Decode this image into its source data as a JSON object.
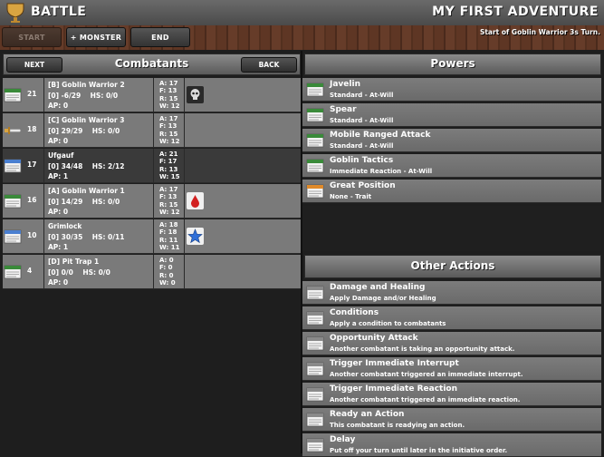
{
  "header": {
    "title": "BATTLE",
    "adventure": "MY FIRST ADVENTURE"
  },
  "toolbar": {
    "start_label": "START",
    "monster_label": "+ MONSTER",
    "end_label": "END",
    "turn_status": "Start of Goblin Warrior 3s Turn."
  },
  "combatants_panel": {
    "title": "Combatants",
    "next_label": "NEXT",
    "back_label": "BACK"
  },
  "combatants": [
    {
      "init": "21",
      "name": "[B] Goblin Warrior 2",
      "hp": "[0] -6/29",
      "hs": "HS: 0/0",
      "ap": "AP:  0",
      "a": "A:  17",
      "f": "F:  13",
      "r": "R:  15",
      "w": "W:  12",
      "condition": "skull-icon",
      "sheet": "green-sheet-icon"
    },
    {
      "init": "18",
      "name": "[C] Goblin Warrior 3",
      "hp": "[0] 29/29",
      "hs": "HS: 0/0",
      "ap": "AP:  0",
      "a": "A:  17",
      "f": "F:  13",
      "r": "R:  15",
      "w": "W:  12",
      "condition": "",
      "sheet": "sword-icon"
    },
    {
      "init": "17",
      "name": "Ufgauf",
      "hp": "[0] 34/48",
      "hs": "HS: 2/12",
      "ap": "AP:  1",
      "a": "A:  21",
      "f": "F:  17",
      "r": "R:  13",
      "w": "W:  15",
      "condition": "",
      "sheet": "blue-sheet-icon"
    },
    {
      "init": "16",
      "name": "[A] Goblin Warrior 1",
      "hp": "[0] 14/29",
      "hs": "HS: 0/0",
      "ap": "AP:  0",
      "a": "A:  17",
      "f": "F:  13",
      "r": "R:  15",
      "w": "W:  12",
      "condition": "blood-drop-icon",
      "sheet": "green-sheet-icon"
    },
    {
      "init": "10",
      "name": "Grimlock",
      "hp": "[0] 30/35",
      "hs": "HS: 0/11",
      "ap": "AP:  1",
      "a": "A:  18",
      "f": "F:  18",
      "r": "R:  11",
      "w": "W:  11",
      "condition": "star-icon",
      "sheet": "blue-sheet-icon"
    },
    {
      "init": "4",
      "name": "[D] Pit Trap 1",
      "hp": "[0] 0/0",
      "hs": "HS: 0/0",
      "ap": "AP:  0",
      "a": "A:  0",
      "f": "F:  0",
      "r": "R:  0",
      "w": "W:  0",
      "condition": "",
      "sheet": "green-sheet-icon"
    }
  ],
  "powers_panel": {
    "title": "Powers"
  },
  "powers": [
    {
      "title": "Javelin",
      "sub": "Standard - At-Will",
      "icon": "green-sheet-icon"
    },
    {
      "title": "Spear",
      "sub": "Standard - At-Will",
      "icon": "green-sheet-icon"
    },
    {
      "title": "Mobile Ranged Attack",
      "sub": "Standard - At-Will",
      "icon": "green-sheet-icon"
    },
    {
      "title": "Goblin Tactics",
      "sub": "Immediate Reaction - At-Will",
      "icon": "green-sheet-icon"
    },
    {
      "title": "Great Position",
      "sub": "None - Trait",
      "icon": "orange-sheet-icon"
    }
  ],
  "other_actions_panel": {
    "title": "Other Actions"
  },
  "other_actions": [
    {
      "title": "Damage and Healing",
      "sub": "Apply Damage and/or Healing"
    },
    {
      "title": "Conditions",
      "sub": "Apply a condition to combatants"
    },
    {
      "title": "Opportunity Attack",
      "sub": "Another combatant is taking an opportunity attack."
    },
    {
      "title": "Trigger Immediate Interrupt",
      "sub": "Another combatant triggered an immediate interrupt."
    },
    {
      "title": "Trigger Immediate Reaction",
      "sub": "Another combatant triggered an immediate reaction."
    },
    {
      "title": "Ready an Action",
      "sub": "This combatant is readying an action."
    },
    {
      "title": "Delay",
      "sub": "Put off your turn until later in the initiative order."
    }
  ],
  "colors": {
    "sheet_green": "#3a8a3a",
    "sheet_blue": "#4a7fd0",
    "sheet_orange": "#e08a2a",
    "sheet_grey": "#8a8a8a",
    "active_row": "#3a3a3a"
  }
}
